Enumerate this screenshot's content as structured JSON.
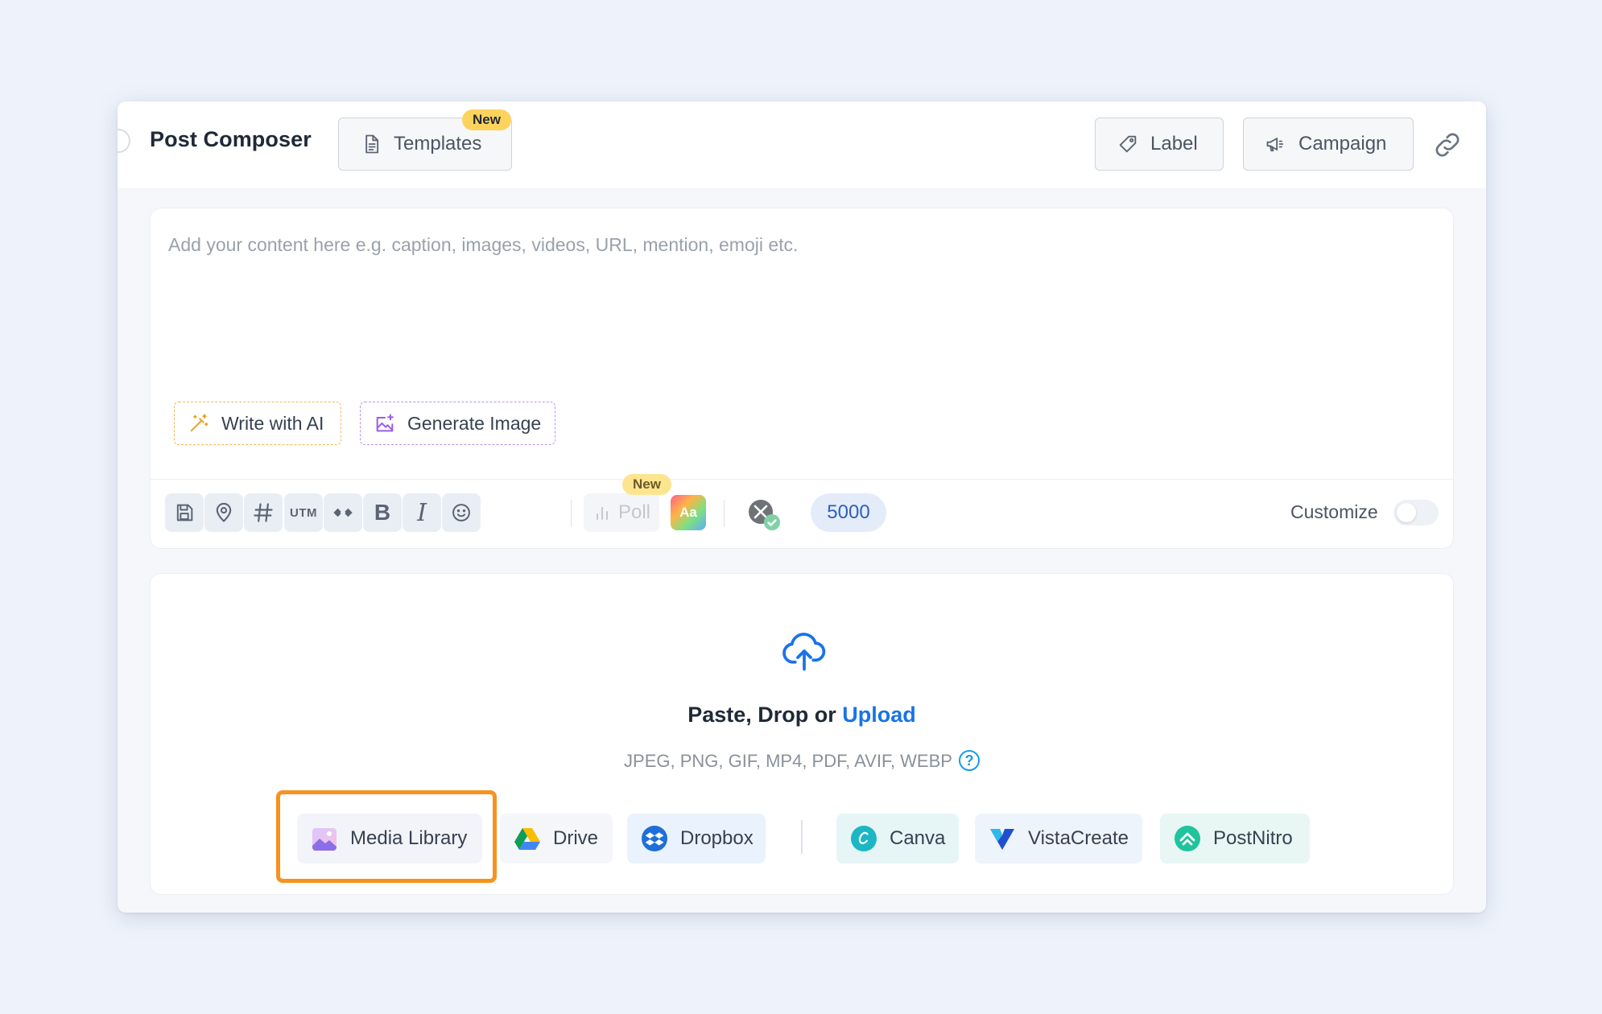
{
  "header": {
    "title": "Post Composer",
    "templates_label": "Templates",
    "templates_badge": "New",
    "label_button": "Label",
    "campaign_button": "Campaign"
  },
  "editor": {
    "placeholder": "Add your content here e.g. caption, images, videos, URL, mention, emoji etc.",
    "write_ai_label": "Write with AI",
    "generate_image_label": "Generate Image",
    "toolbar": {
      "utm_label": "UTM",
      "bold_label": "B",
      "italic_label": "I",
      "poll_label": "Poll",
      "poll_badge": "New",
      "aa_label": "Aa",
      "char_count": "5000",
      "customize_label": "Customize"
    }
  },
  "upload": {
    "prompt_prefix": "Paste, Drop or",
    "prompt_link": "Upload",
    "formats": "JPEG, PNG, GIF, MP4, PDF, AVIF, WEBP",
    "help_glyph": "?",
    "sources": {
      "media_library": "Media Library",
      "drive": "Drive",
      "dropbox": "Dropbox",
      "canva": "Canva",
      "vistacreate": "VistaCreate",
      "postnitro": "PostNitro"
    }
  },
  "colors": {
    "accent_link": "#1a73e8",
    "highlight": "#f7921e",
    "badge": "#fdd35c"
  }
}
